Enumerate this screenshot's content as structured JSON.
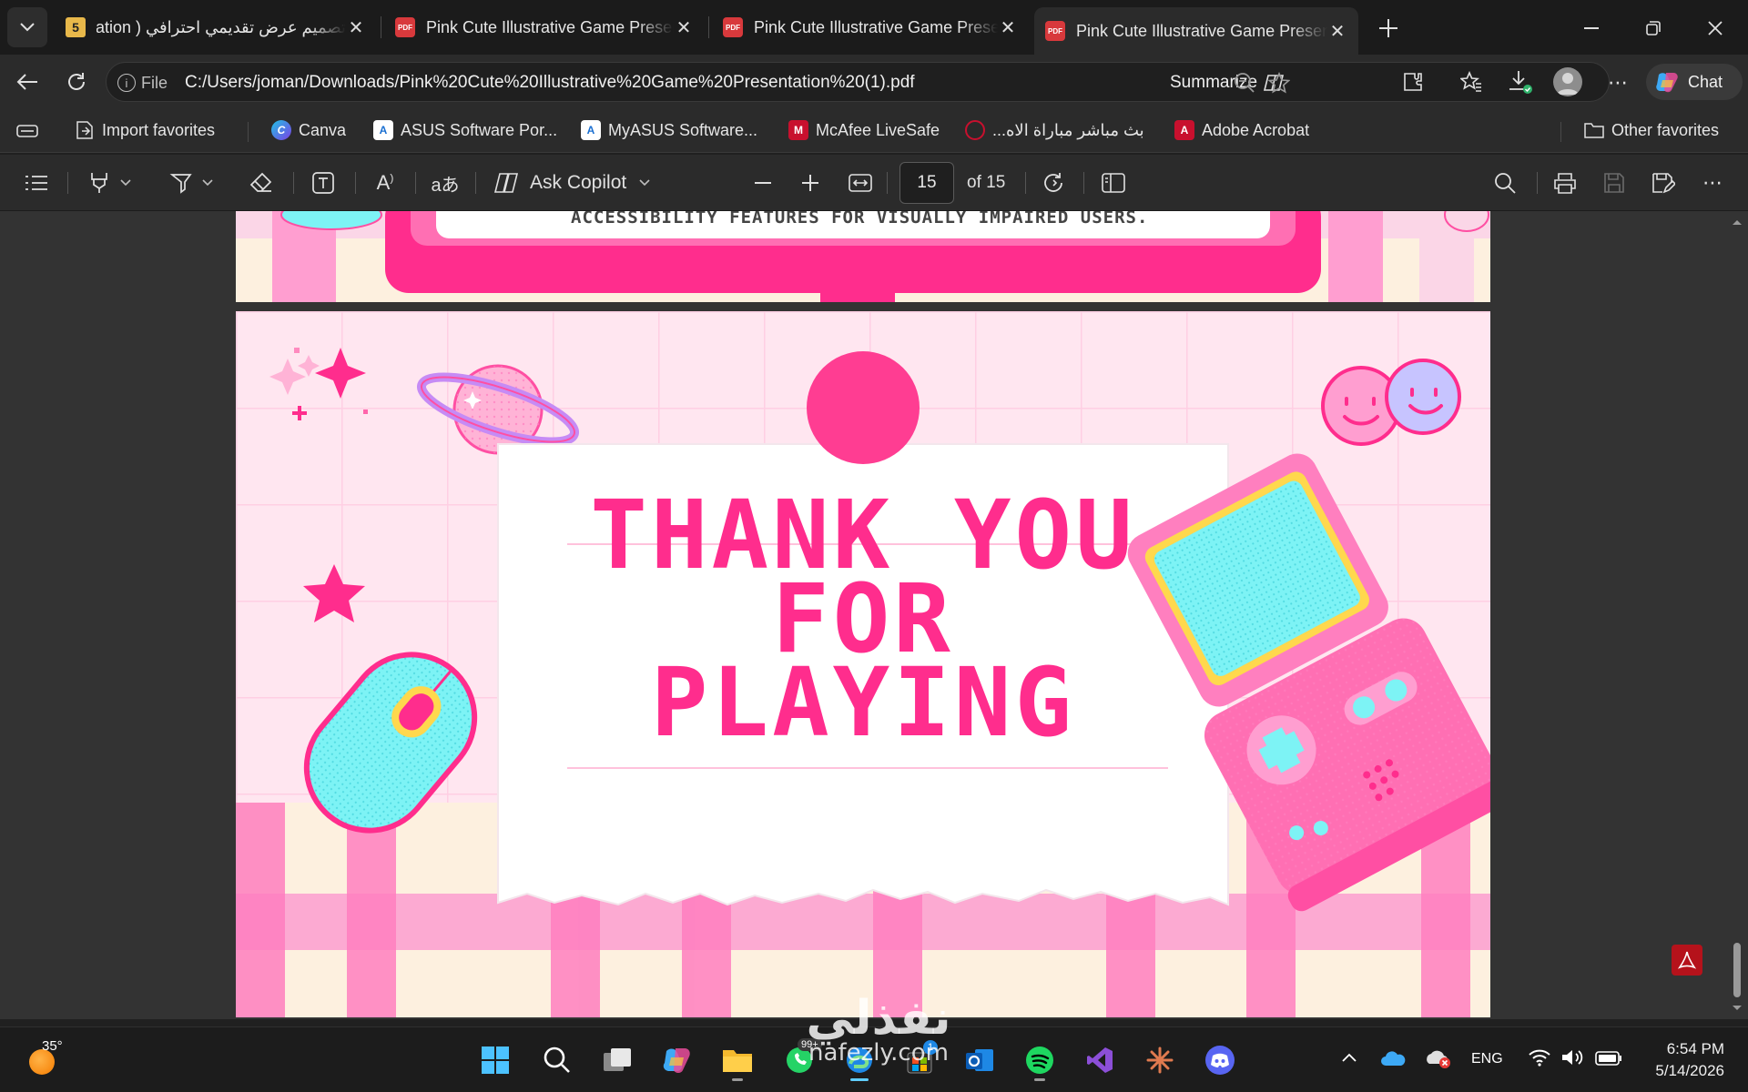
{
  "tabs": [
    {
      "title": "تصميم عرض تقديمي احترافي ( ation",
      "favicon": "5",
      "active": false
    },
    {
      "title": "Pink Cute Illustrative Game Presentation",
      "favicon": "PDF",
      "active": false
    },
    {
      "title": "Pink Cute Illustrative Game Presentation",
      "favicon": "PDF",
      "active": false
    },
    {
      "title": "Pink Cute Illustrative Game Presentation",
      "favicon": "PDF",
      "active": true
    }
  ],
  "address": {
    "scheme_label": "File",
    "url": "C:/Users/joman/Downloads/Pink%20Cute%20Illustrative%20Game%20Presentation%20(1).pdf",
    "summarize_label": "Summarize",
    "chat_label": "Chat"
  },
  "favorites": [
    {
      "label": "Import favorites",
      "icon": "import-icon"
    },
    {
      "label": "Canva",
      "icon": "canva-icon"
    },
    {
      "label": "ASUS Software Por...",
      "icon": "asus-icon"
    },
    {
      "label": "MyASUS Software...",
      "icon": "asus-icon"
    },
    {
      "label": "McAfee LiveSafe",
      "icon": "mcafee-icon"
    },
    {
      "label": "بث مباشر مباراة الاه...",
      "icon": "sports-icon"
    },
    {
      "label": "Adobe Acrobat",
      "icon": "acrobat-icon"
    },
    {
      "label": "Other favorites",
      "icon": "folder-icon"
    }
  ],
  "pdf_toolbar": {
    "ask_copilot": "Ask Copilot",
    "current_page": "15",
    "page_total": "of 15"
  },
  "slide_prev": {
    "caption": "ACCESSIBILITY FEATURES FOR VISUALLY IMPAIRED USERS."
  },
  "slide": {
    "line1": "THANK YOU",
    "line2": "FOR",
    "line3": "PLAYING",
    "colors": {
      "pink": "#ff2d8d",
      "light_pink": "#ffe6f0",
      "cyan": "#7df3f5",
      "cream": "#fdf4dc"
    }
  },
  "watermark": {
    "arabic": "نفذلي",
    "latin": "nafezly.com"
  },
  "taskbar": {
    "weather_temp": "35°",
    "language": "ENG",
    "time": "6:54 PM",
    "date": "5/14/2026",
    "badge_whatsapp": "99+",
    "badge_store": "1"
  }
}
